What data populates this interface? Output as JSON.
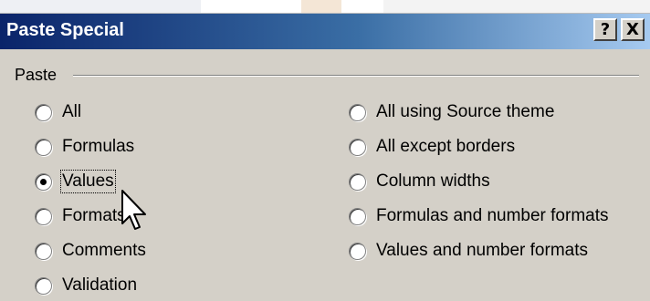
{
  "dialog": {
    "title": "Paste Special",
    "help_button": "?",
    "close_button": "X"
  },
  "paste_group": {
    "label": "Paste",
    "left_options": [
      {
        "label": "All",
        "checked": false
      },
      {
        "label": "Formulas",
        "checked": false
      },
      {
        "label": "Values",
        "checked": true
      },
      {
        "label": "Formats",
        "checked": false
      },
      {
        "label": "Comments",
        "checked": false
      },
      {
        "label": "Validation",
        "checked": false
      }
    ],
    "right_options": [
      {
        "label": "All using Source theme",
        "checked": false
      },
      {
        "label": "All except borders",
        "checked": false
      },
      {
        "label": "Column widths",
        "checked": false
      },
      {
        "label": "Formulas and number formats",
        "checked": false
      },
      {
        "label": "Values and number formats",
        "checked": false
      }
    ]
  },
  "colors": {
    "dialog_bg": "#d4d0c8",
    "titlebar_start": "#0a246a",
    "titlebar_end": "#a6caf0"
  }
}
